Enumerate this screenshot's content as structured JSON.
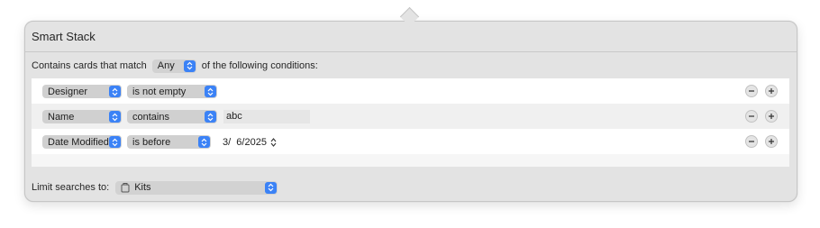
{
  "window": {
    "title": "Smart Stack"
  },
  "match": {
    "prefix": "Contains cards that match",
    "selector": "Any",
    "suffix": "of the following conditions:"
  },
  "rules": [
    {
      "field": "Designer",
      "operator": "is not empty"
    },
    {
      "field": "Name",
      "operator": "contains",
      "value": "abc"
    },
    {
      "field": "Date Modified",
      "operator": "is before",
      "date": "3/  6/2025"
    }
  ],
  "limit": {
    "label": "Limit searches to:",
    "selection": "Kits"
  },
  "icons": {
    "popup_chevrons": "chevron-up-down-icon",
    "remove": "minus-icon",
    "add": "plus-icon",
    "stepper": "stepper-icon",
    "kit": "kit-icon"
  },
  "colors": {
    "accent": "#3b82f6",
    "panel": "#e3e3e3"
  }
}
